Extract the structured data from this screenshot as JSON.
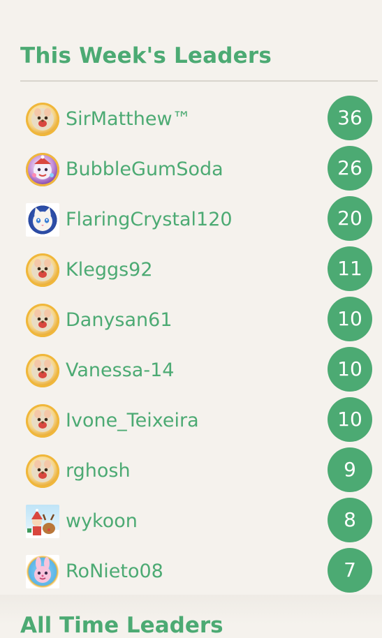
{
  "section": {
    "title": "This Week's Leaders",
    "next_title": "All Time Leaders"
  },
  "colors": {
    "accent": "#4caa73",
    "background": "#f5f2ed",
    "badge_text": "#ffffff",
    "divider": "#d8d4cd"
  },
  "leaders": [
    {
      "name": "SirMatthew™",
      "score": "36",
      "avatar": "golden-hamster-avatar-icon"
    },
    {
      "name": "BubbleGumSoda",
      "score": "26",
      "avatar": "purple-bubble-character-avatar-icon"
    },
    {
      "name": "FlaringCrystal120",
      "score": "20",
      "avatar": "white-cat-avatar-icon"
    },
    {
      "name": "Kleggs92",
      "score": "11",
      "avatar": "golden-hamster-avatar-icon"
    },
    {
      "name": "Danysan61",
      "score": "10",
      "avatar": "golden-hamster-avatar-icon"
    },
    {
      "name": "Vanessa-14",
      "score": "10",
      "avatar": "golden-hamster-avatar-icon"
    },
    {
      "name": "Ivone_Teixeira",
      "score": "10",
      "avatar": "golden-hamster-avatar-icon"
    },
    {
      "name": "rghosh",
      "score": "9",
      "avatar": "golden-hamster-avatar-icon"
    },
    {
      "name": "wykoon",
      "score": "8",
      "avatar": "christmas-reindeer-avatar-icon"
    },
    {
      "name": "RoNieto08",
      "score": "7",
      "avatar": "pink-bunny-avatar-icon"
    }
  ]
}
